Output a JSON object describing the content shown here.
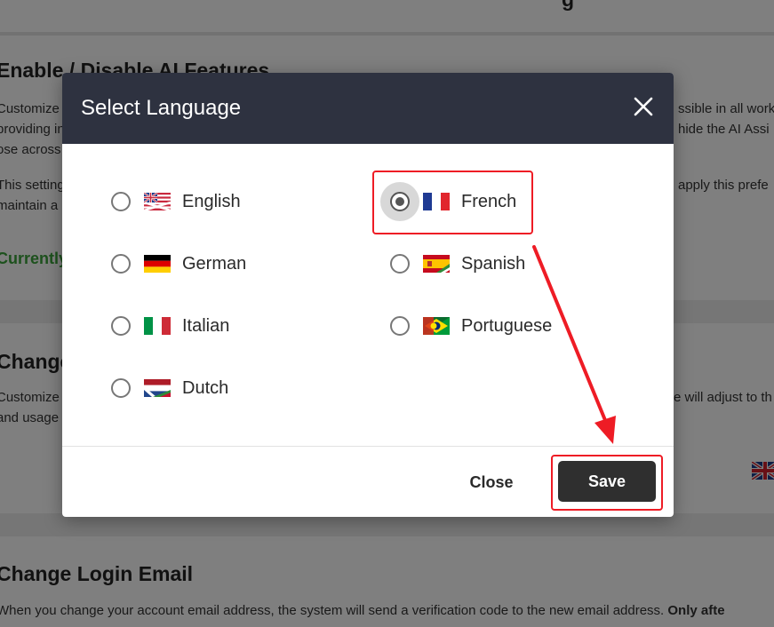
{
  "background": {
    "top_heading": "g",
    "ai_section": {
      "heading": "Enable / Disable AI Features",
      "line1_left": "Customize",
      "line1_right": "ssible in all work",
      "line2_left": "providing in",
      "line2_right": "hide the AI Assi",
      "line3_left": "ose across",
      "line4_left": "This setting",
      "line4_right": "apply this prefe",
      "line5_left": "maintain a",
      "status_left": "Currently"
    },
    "language_section": {
      "heading": "Change",
      "line1_left": "Customize",
      "line1_right": "e will adjust to th",
      "line2_left": "and usage"
    },
    "email_section": {
      "heading": "Change Login Email",
      "text_normal": "When you change your account email address, the system will send a verification code to the new email address. ",
      "text_bold": "Only afte"
    }
  },
  "modal": {
    "title": "Select Language",
    "close_label": "Close",
    "save_label": "Save",
    "options": [
      {
        "label": "English",
        "flag": "uk-flag-icon",
        "checked": false
      },
      {
        "label": "French",
        "flag": "france-flag-icon",
        "checked": true
      },
      {
        "label": "German",
        "flag": "germany-flag-icon",
        "checked": false
      },
      {
        "label": "Spanish",
        "flag": "spain-flag-icon",
        "checked": false
      },
      {
        "label": "Italian",
        "flag": "italy-flag-icon",
        "checked": false
      },
      {
        "label": "Portuguese",
        "flag": "portugal-flag-icon",
        "checked": false
      },
      {
        "label": "Dutch",
        "flag": "netherlands-flag-icon",
        "checked": false
      }
    ]
  },
  "colors": {
    "header_bg": "#2e3240",
    "annotation_red": "#ee1c25",
    "save_button_bg": "#2f2f2f",
    "status_green": "#3aa33a"
  }
}
